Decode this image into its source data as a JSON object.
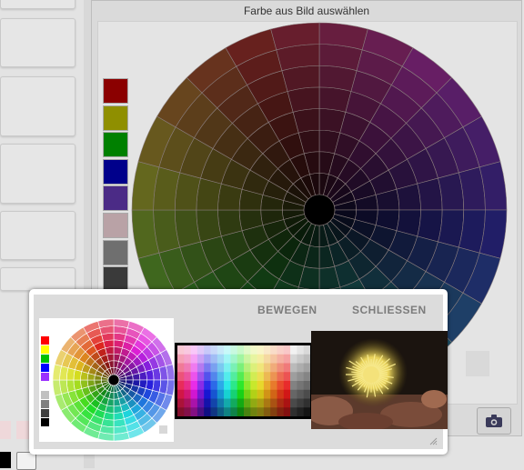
{
  "panel": {
    "title": "Farbe aus Bild auswählen"
  },
  "popup": {
    "move_label": "BEWEGEN",
    "close_label": "SCHLIESSEN"
  },
  "icons": {
    "camera": "camera-icon",
    "resize": "resize-grip-icon"
  },
  "colors": {
    "swatches": [
      "#8b0000",
      "#8f8f00",
      "#008000",
      "#00008b",
      "#4b2b86",
      "#b9a2a6",
      "#6f6f6f",
      "#3a3a3a"
    ],
    "mini_swatches": [
      "#ff0000",
      "#ffff00",
      "#00c000",
      "#0000ff",
      "#9b30ff",
      "#ffffff",
      "#c0c0c0",
      "#808080",
      "#404040",
      "#000000"
    ]
  }
}
